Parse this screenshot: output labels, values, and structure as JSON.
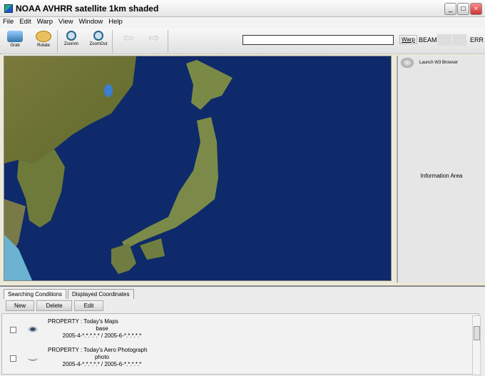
{
  "window": {
    "title": "NOAA AVHRR satellite 1km shaded",
    "controls": [
      "_",
      "□",
      "×"
    ]
  },
  "menu": [
    "File",
    "Edit",
    "Warp",
    "View",
    "Window",
    "Help"
  ],
  "toolbar": {
    "grab": "Grab",
    "rotate": "Rotate",
    "zoom_in": "ZoomIn",
    "zoom_out": "ZoomOut",
    "search_value": "",
    "warp": "Warp",
    "beam": "BEAM",
    "err": "ERR"
  },
  "info": {
    "launch": "Launch W3 Browser",
    "label": "Information Area"
  },
  "bottom": {
    "tabs": [
      "Searching Conditions",
      "Displayed Coordinates"
    ],
    "buttons": [
      "New",
      "Delete",
      "Edit"
    ],
    "rows": [
      {
        "property": "PROPERTY : Today's Maps",
        "type": "base",
        "range": "2005-4-*.*.*.*.* / 2005-6-*.*.*.*.*",
        "icon": "eye-icon",
        "checked": false
      },
      {
        "property": "PROPERTY : Today's Aero Photograph",
        "type": "photo",
        "range": "2005-4-*.*.*.*.* / 2005-6-*.*.*.*.*",
        "icon": "lens-icon",
        "checked": false
      }
    ]
  }
}
